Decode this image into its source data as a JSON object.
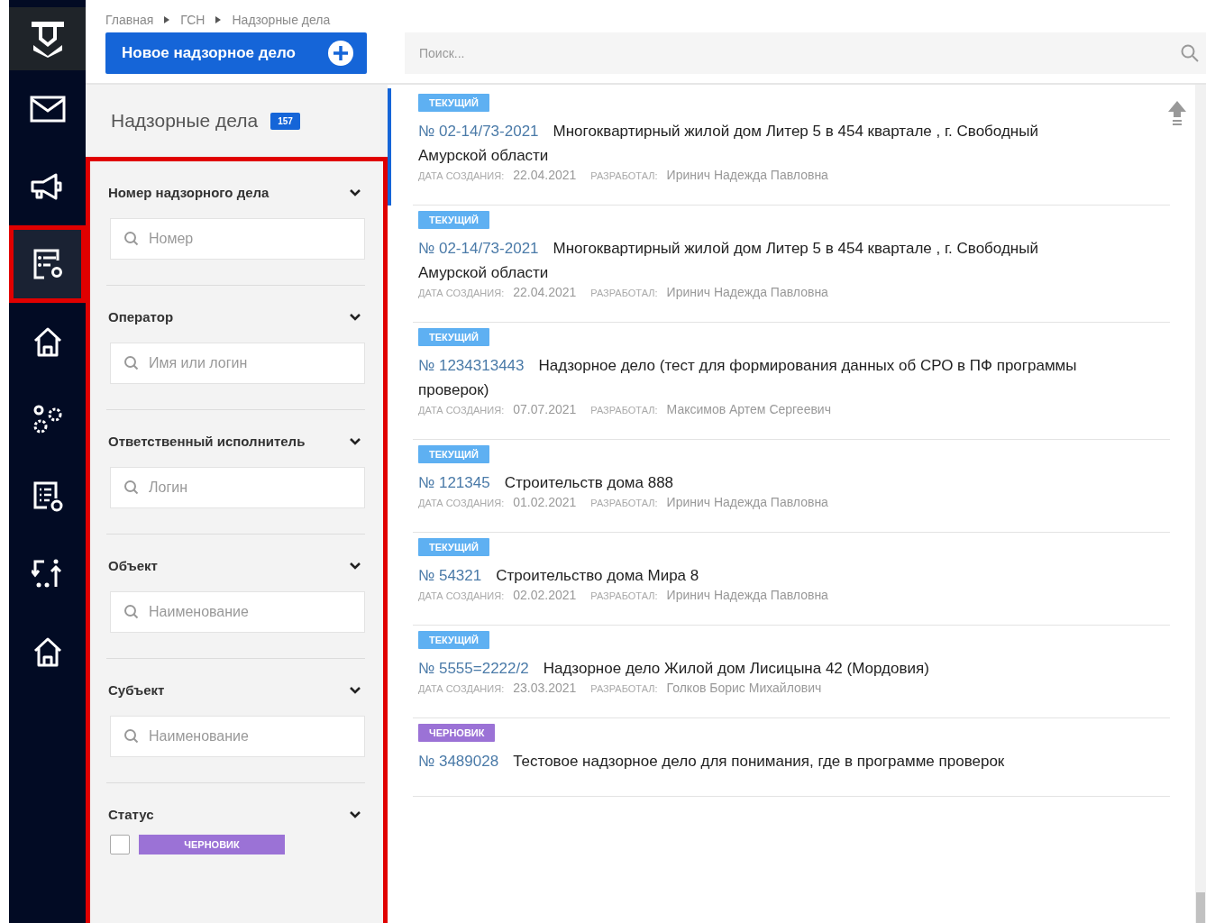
{
  "breadcrumbs": [
    "Главная",
    "ГСН",
    "Надзорные дела"
  ],
  "new_button": {
    "label": "Новое надзорное дело"
  },
  "search": {
    "placeholder": "Поиск..."
  },
  "sidebar": {
    "items": [
      {
        "selected": false
      },
      {
        "selected": false
      },
      {
        "selected": true
      },
      {
        "selected": false
      },
      {
        "selected": false
      },
      {
        "selected": false
      },
      {
        "selected": false
      },
      {
        "selected": false
      }
    ]
  },
  "filters": {
    "title": "Надзорные дела",
    "count": "157",
    "groups": [
      {
        "kind": "search",
        "label": "Номер надзорного дела",
        "expanded": true,
        "placeholder": "Номер"
      },
      {
        "kind": "search",
        "label": "Оператор",
        "expanded": true,
        "placeholder": "Имя или логин"
      },
      {
        "kind": "search",
        "label": "Ответственный исполнитель",
        "expanded": true,
        "placeholder": "Логин"
      },
      {
        "kind": "search",
        "label": "Объект",
        "expanded": true,
        "placeholder": "Наименование"
      },
      {
        "kind": "search",
        "label": "Субъект",
        "expanded": true,
        "placeholder": "Наименование"
      },
      {
        "kind": "status",
        "label": "Статус",
        "expanded": true,
        "options": [
          {
            "label": "ЧЕРНОВИК",
            "checked": false,
            "color": "#9b72d6"
          }
        ]
      }
    ]
  },
  "cases": [
    {
      "status": "ТЕКУЩИЙ",
      "color": "#5eb0f2",
      "selected": true,
      "number": "№ 02-14/73-2021",
      "title": "Многоквартирный жилой дом Литер 5 в 454 квартале , г. Свободный Амурской области",
      "date_label": "ДАТА СОЗДАНИЯ:",
      "date": "22.04.2021",
      "author_label": "РАЗРАБОТАЛ:",
      "author": "Иринич Надежда Павловна"
    },
    {
      "status": "ТЕКУЩИЙ",
      "color": "#5eb0f2",
      "selected": false,
      "number": "№ 02-14/73-2021",
      "title": "Многоквартирный жилой дом Литер 5 в 454 квартале , г. Свободный Амурской области",
      "date_label": "ДАТА СОЗДАНИЯ:",
      "date": "22.04.2021",
      "author_label": "РАЗРАБОТАЛ:",
      "author": "Иринич Надежда Павловна"
    },
    {
      "status": "ТЕКУЩИЙ",
      "color": "#5eb0f2",
      "selected": false,
      "number": "№ 1234313443",
      "title": "Надзорное дело (тест для формирования данных об СРО в ПФ программы проверок)",
      "date_label": "ДАТА СОЗДАНИЯ:",
      "date": "07.07.2021",
      "author_label": "РАЗРАБОТАЛ:",
      "author": "Максимов Артем Сергеевич"
    },
    {
      "status": "ТЕКУЩИЙ",
      "color": "#5eb0f2",
      "selected": false,
      "number": "№ 121345",
      "title": "Строительств дома 888",
      "date_label": "ДАТА СОЗДАНИЯ:",
      "date": "01.02.2021",
      "author_label": "РАЗРАБОТАЛ:",
      "author": "Иринич Надежда Павловна"
    },
    {
      "status": "ТЕКУЩИЙ",
      "color": "#5eb0f2",
      "selected": false,
      "number": "№ 54321",
      "title": "Строительство дома Мира 8",
      "date_label": "ДАТА СОЗДАНИЯ:",
      "date": "02.02.2021",
      "author_label": "РАЗРАБОТАЛ:",
      "author": "Иринич Надежда Павловна"
    },
    {
      "status": "ТЕКУЩИЙ",
      "color": "#5eb0f2",
      "selected": false,
      "number": "№ 5555=2222/2",
      "title": "Надзорное дело Жилой дом Лисицына 42 (Мордовия)",
      "date_label": "ДАТА СОЗДАНИЯ:",
      "date": "23.03.2021",
      "author_label": "РАЗРАБОТАЛ:",
      "author": "Голков Борис Михайлович"
    },
    {
      "status": "ЧЕРНОВИК",
      "color": "#9b72d6",
      "selected": false,
      "number": "№ 3489028",
      "title": "Тестовое надзорное дело для понимания, где в программе проверок"
    }
  ]
}
